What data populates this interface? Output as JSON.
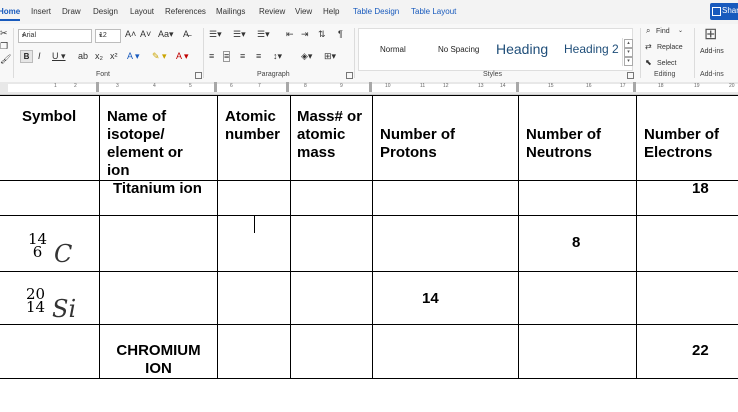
{
  "ribbon_tabs": [
    "Home",
    "Insert",
    "Draw",
    "Design",
    "Layout",
    "References",
    "Mailings",
    "Review",
    "View",
    "Help",
    "Table Design",
    "Table Layout"
  ],
  "share_label": "Share",
  "font": {
    "name": "Arial",
    "size": "12"
  },
  "groups": {
    "font": "Font",
    "paragraph": "Paragraph",
    "styles": "Styles",
    "editing": "Editing",
    "addins": "Add-ins"
  },
  "styles": [
    "Normal",
    "No Spacing",
    "Heading",
    "Heading 2"
  ],
  "editing": {
    "find": "Find",
    "replace": "Replace",
    "select": "Select"
  },
  "addins_label": "Add-ins",
  "ruler_numbers": [
    "1",
    "2",
    "3",
    "4",
    "5",
    "6",
    "7",
    "8",
    "9",
    "10",
    "11",
    "12",
    "13",
    "14",
    "15",
    "16",
    "17",
    "18",
    "19",
    "20"
  ],
  "table": {
    "headers": {
      "symbol": "Symbol",
      "name": [
        "Name of",
        "isotope/",
        "element or",
        "ion"
      ],
      "atomic": [
        "Atomic",
        "number"
      ],
      "mass": [
        "Mass# or",
        "atomic",
        "mass"
      ],
      "protons": [
        "Number of",
        "Protons"
      ],
      "neutrons": [
        "Number of",
        "Neutrons"
      ],
      "electrons": [
        "Number of",
        "Electrons"
      ]
    },
    "rows": [
      {
        "name": "Titanium ion",
        "electrons": "18"
      },
      {
        "symbol": {
          "mass": "14",
          "atomic": "6",
          "element": "C"
        },
        "neutrons": "8"
      },
      {
        "symbol": {
          "mass": "20",
          "atomic": "14",
          "element": "Si"
        },
        "protons": "14"
      },
      {
        "name": [
          "CHROMIUM",
          "ION"
        ],
        "electrons": "22"
      }
    ]
  }
}
